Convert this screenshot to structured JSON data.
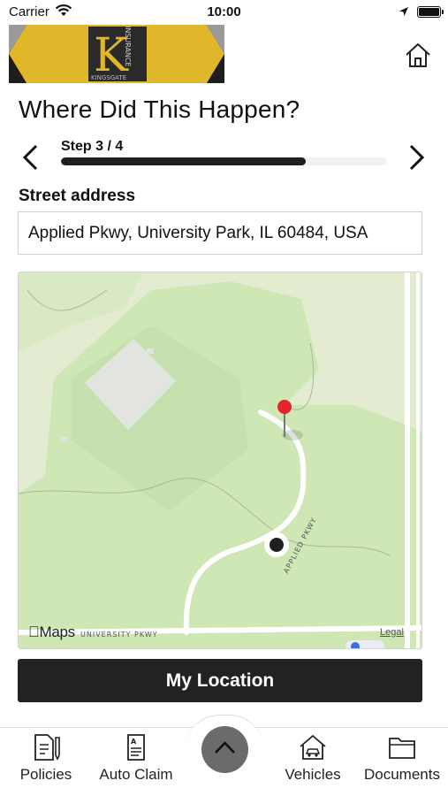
{
  "status_bar": {
    "carrier": "Carrier",
    "time": "10:00",
    "icons": [
      "wifi-icon",
      "location-arrow-icon",
      "battery-icon"
    ]
  },
  "header": {
    "logo_text": "K",
    "logo_subtext": "KINGSGATE",
    "logo_vertical_text": "INSURANCE",
    "home_icon": "home-icon"
  },
  "page": {
    "title": "Where Did This Happen?"
  },
  "stepper": {
    "label": "Step 3 / 4",
    "current": 3,
    "total": 4,
    "progress": 0.75,
    "prev_icon": "chevron-left-icon",
    "next_icon": "chevron-right-icon"
  },
  "address": {
    "label": "Street address",
    "value": "Applied Pkwy, University Park, IL 60484, USA"
  },
  "map": {
    "brand": "Maps",
    "legal": "Legal",
    "road_label_applied": "APPLIED PKWY",
    "road_label_university": "UNIVERSITY PKWY",
    "pin_icon": "map-pin-icon",
    "current_location_icon": "current-location-dot-icon"
  },
  "actions": {
    "my_location": "My Location"
  },
  "tab_bar": {
    "items": [
      {
        "label": "Policies",
        "icon": "policy-document-icon"
      },
      {
        "label": "Auto Claim",
        "icon": "claim-form-icon"
      },
      {
        "label": "Vehicles",
        "icon": "car-house-icon"
      },
      {
        "label": "Documents",
        "icon": "folder-icon"
      }
    ],
    "center_icon": "chevron-up-icon"
  },
  "colors": {
    "brand_yellow": "#e0b62a",
    "dark": "#222222",
    "map_park": "#cfe6b5",
    "map_base": "#e3ecd0",
    "pin_red": "#e3262b"
  }
}
